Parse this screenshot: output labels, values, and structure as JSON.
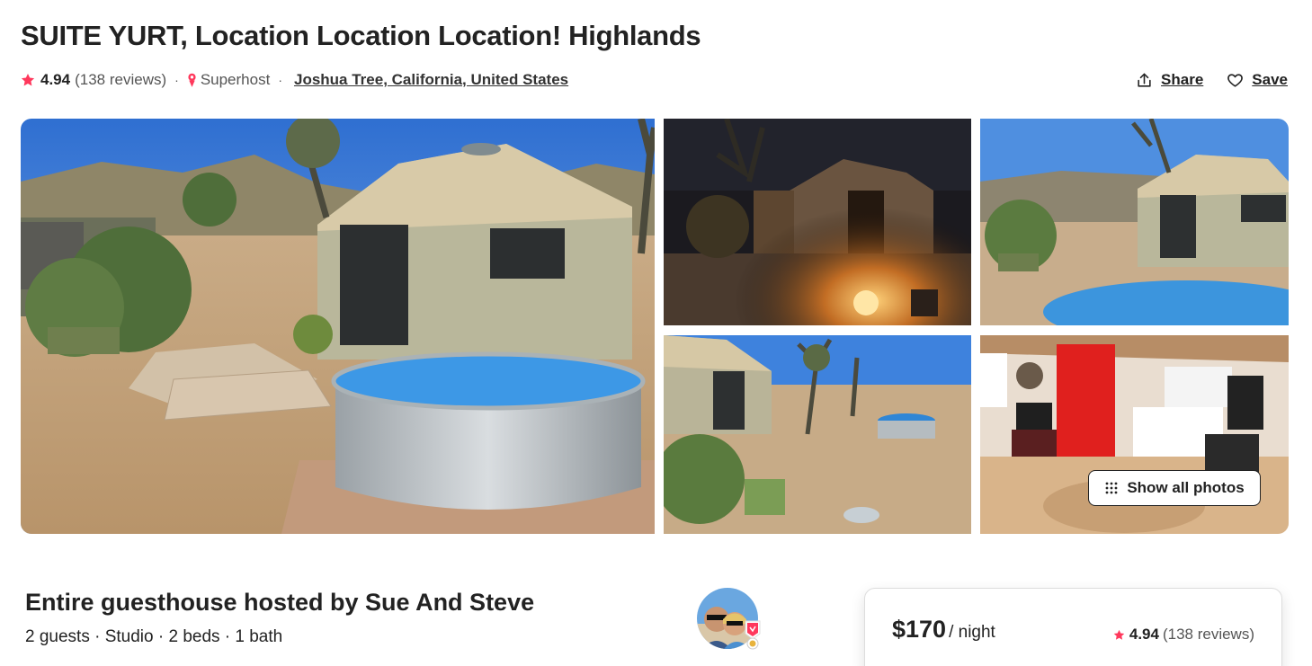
{
  "listing": {
    "title": "SUITE YURT, Location Location Location! Highlands",
    "rating": "4.94",
    "reviews": "(138 reviews)",
    "separator": "·",
    "superhost": "Superhost",
    "location": "Joshua Tree, California, United States"
  },
  "actions": {
    "share": "Share",
    "save": "Save"
  },
  "gallery": {
    "show_all": "Show all photos",
    "photos": [
      "yurt-exterior-with-stock-tank-pool",
      "yurt-at-night-with-fire-pit",
      "yurt-with-pool-view",
      "yard-and-joshua-trees",
      "interior-with-red-curtains"
    ]
  },
  "host": {
    "title": "Entire guesthouse hosted by Sue And Steve",
    "details": "2 guests · Studio · 2 beds · 1 bath"
  },
  "booking": {
    "price": "$170",
    "per": "/ night",
    "rating": "4.94",
    "reviews": "(138 reviews)"
  },
  "colors": {
    "accent": "#FF385C",
    "text": "#222222",
    "muted": "#555555"
  }
}
